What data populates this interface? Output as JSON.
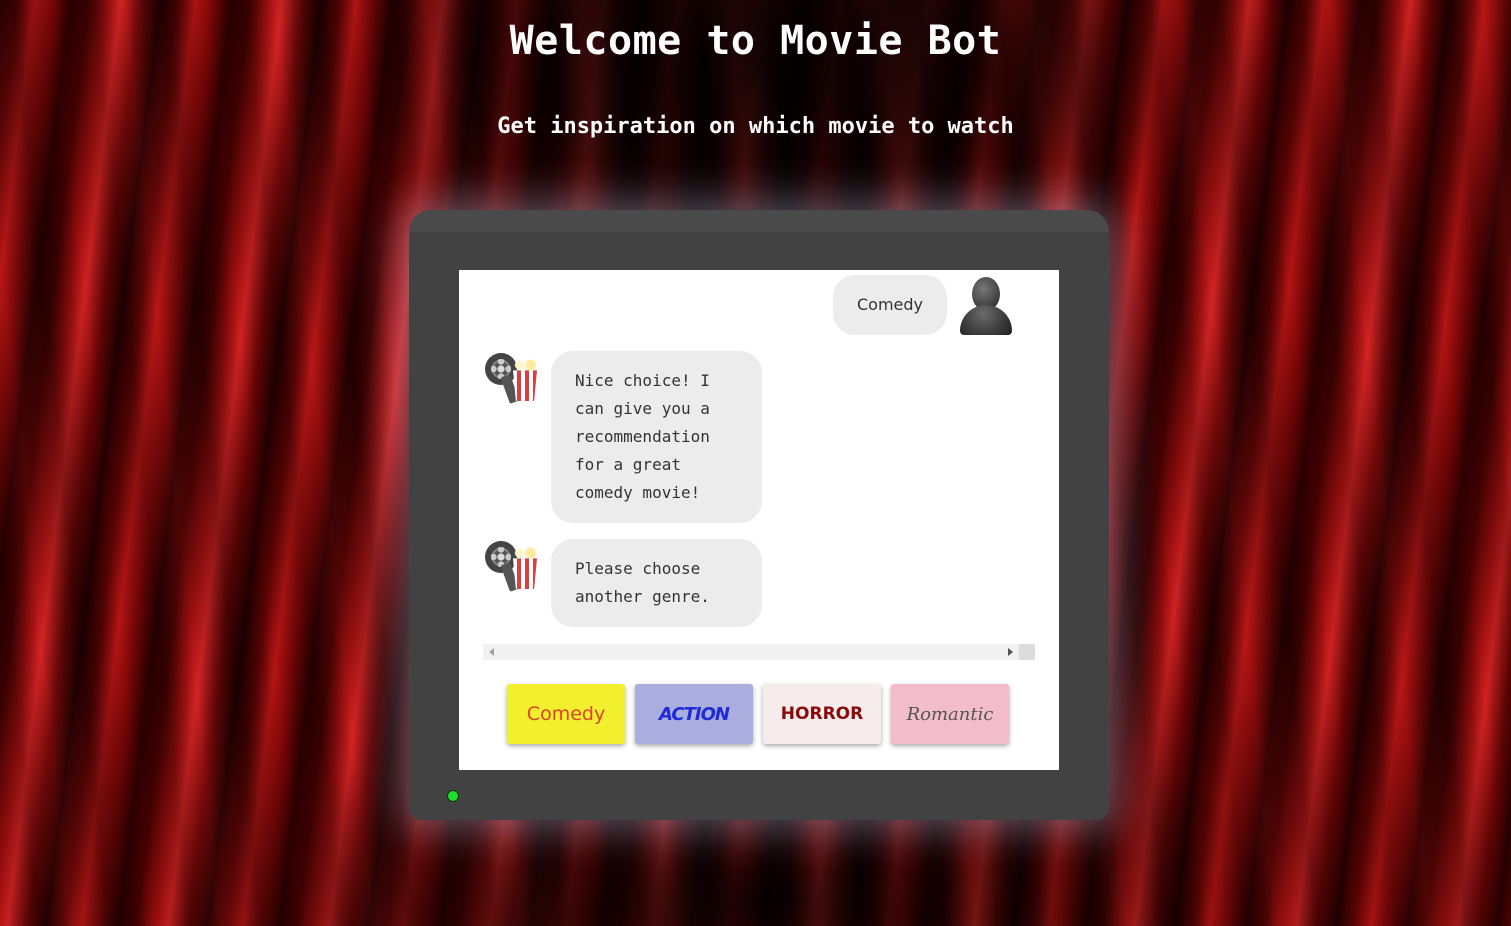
{
  "header": {
    "title": "Welcome to Movie Bot",
    "subtitle": "Get inspiration on which movie to watch"
  },
  "chat": {
    "messages": [
      {
        "sender": "user",
        "text": "Comedy"
      },
      {
        "sender": "bot",
        "text": "Nice choice! I can give you a recommendation for a great comedy movie!"
      },
      {
        "sender": "bot",
        "text": "Please choose another genre."
      }
    ]
  },
  "genres": {
    "comedy": "Comedy",
    "action": "ACTION",
    "horror": "HORROR",
    "romantic": "Romantic"
  },
  "icons": {
    "user_avatar": "user-silhouette-icon",
    "bot_avatar": "film-reel-popcorn-icon",
    "power_indicator": "power-led-icon"
  },
  "colors": {
    "comedy_bg": "#f2ef2e",
    "action_bg": "#a9aedf",
    "horror_bg": "#f6ecec",
    "romantic_bg": "#f2bccb",
    "power_led": "#1fdc2e",
    "tv_frame": "#424242"
  }
}
